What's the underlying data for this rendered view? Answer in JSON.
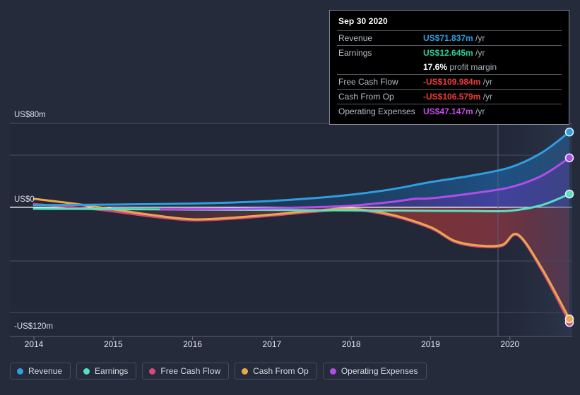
{
  "chart_data": {
    "type": "line",
    "title": "",
    "xlabel": "",
    "ylabel": "",
    "x_tick_labels": [
      "2014",
      "2015",
      "2016",
      "2017",
      "2018",
      "2019",
      "2020"
    ],
    "y_tick_labels": [
      "US$80m",
      "US$0",
      "-US$120m"
    ],
    "ylim": [
      -120,
      80
    ],
    "xlim": [
      2014,
      2020.75
    ],
    "grid": true,
    "legend_position": "bottom-left",
    "currency": "US$",
    "units": "millions",
    "series": [
      {
        "name": "Revenue",
        "color": "#2e9fe0",
        "x": [
          2014.0,
          2014.5,
          2015.0,
          2015.5,
          2016.0,
          2016.5,
          2017.0,
          2017.5,
          2018.0,
          2018.5,
          2019.0,
          2019.5,
          2020.0,
          2020.4,
          2020.75
        ],
        "values": [
          2.0,
          2.2,
          2.6,
          3.0,
          3.5,
          4.5,
          6.0,
          8.5,
          12.0,
          17.0,
          24.0,
          30.0,
          38.0,
          52.0,
          71.837
        ]
      },
      {
        "name": "Earnings",
        "color": "#55dfc3",
        "x": [
          2014.0,
          2014.5,
          2015.0,
          2015.5,
          2016.0,
          2016.5,
          2017.0,
          2017.5,
          2018.0,
          2018.5,
          2019.0,
          2019.5,
          2020.0,
          2020.4,
          2020.75
        ],
        "values": [
          -1.5,
          -1.6,
          -1.8,
          -2.0,
          -2.2,
          -2.4,
          -2.6,
          -2.8,
          -3.0,
          -3.2,
          -3.4,
          -3.6,
          -3.4,
          2.0,
          12.645
        ]
      },
      {
        "name": "Free Cash Flow",
        "color": "#d8487b",
        "x": [
          2014.0,
          2014.5,
          2015.0,
          2015.5,
          2016.0,
          2016.5,
          2017.0,
          2017.5,
          2018.0,
          2018.5,
          2019.0,
          2019.3,
          2019.6,
          2019.9,
          2020.1,
          2020.4,
          2020.75
        ],
        "values": [
          3.0,
          0.0,
          -4.0,
          -9.0,
          -12.5,
          -11.0,
          -8.0,
          -4.5,
          -2.5,
          -8.0,
          -20.0,
          -33.0,
          -37.5,
          -37.0,
          -27.0,
          -60.0,
          -109.984
        ]
      },
      {
        "name": "Cash From Op",
        "color": "#e8a84c",
        "x": [
          2014.0,
          2014.5,
          2015.0,
          2015.5,
          2016.0,
          2016.5,
          2017.0,
          2017.5,
          2018.0,
          2018.5,
          2019.0,
          2019.3,
          2019.6,
          2019.9,
          2020.1,
          2020.4,
          2020.75
        ],
        "values": [
          8.0,
          3.5,
          -2.0,
          -7.5,
          -11.5,
          -10.0,
          -7.0,
          -3.5,
          -1.5,
          -7.0,
          -19.0,
          -32.0,
          -36.5,
          -36.0,
          -26.0,
          -58.0,
          -106.579
        ]
      },
      {
        "name": "Operating Expenses",
        "color": "#b44ce8",
        "x": [
          2015.6,
          2016.0,
          2016.5,
          2017.0,
          2017.5,
          2018.0,
          2018.5,
          2018.8,
          2019.0,
          2019.5,
          2020.0,
          2020.4,
          2020.75
        ],
        "values": [
          -2.0,
          -1.8,
          -1.5,
          -1.0,
          0.0,
          1.5,
          5.0,
          8.0,
          8.5,
          13.0,
          19.0,
          30.0,
          47.147
        ]
      }
    ],
    "forecast_divider_x": 2019.85,
    "endpoints": [
      {
        "series": "Revenue",
        "value": 71.837
      },
      {
        "series": "Operating Expenses",
        "value": 47.147
      },
      {
        "series": "Earnings",
        "value": 12.645
      },
      {
        "series": "Free Cash Flow",
        "value": -109.984
      },
      {
        "series": "Cash From Op",
        "value": -106.579
      }
    ]
  },
  "tooltip": {
    "title": "Sep 30 2020",
    "rows": [
      {
        "label": "Revenue",
        "value": "US$71.837m",
        "unit": "/yr",
        "color": "#2e9fe0"
      },
      {
        "label": "Earnings",
        "value": "US$12.645m",
        "unit": "/yr",
        "color": "#2ecc9b"
      },
      {
        "label": "",
        "value": "17.6%",
        "unit": "profit margin",
        "color": "#ffffff"
      },
      {
        "label": "Free Cash Flow",
        "value": "-US$109.984m",
        "unit": "/yr",
        "color": "#ef3b3b"
      },
      {
        "label": "Cash From Op",
        "value": "-US$106.579m",
        "unit": "/yr",
        "color": "#ef3b3b"
      },
      {
        "label": "Operating Expenses",
        "value": "US$47.147m",
        "unit": "/yr",
        "color": "#c44ce8"
      }
    ]
  },
  "legend": {
    "items": [
      {
        "label": "Revenue",
        "color": "#2e9fe0"
      },
      {
        "label": "Earnings",
        "color": "#55dfc3"
      },
      {
        "label": "Free Cash Flow",
        "color": "#d8487b"
      },
      {
        "label": "Cash From Op",
        "color": "#e8a84c"
      },
      {
        "label": "Operating Expenses",
        "color": "#b44ce8"
      }
    ]
  },
  "colors": {
    "background": "#252b3b",
    "plot_background": "#222838",
    "gridline": "#4a5163",
    "zero_line": "#ffffff",
    "axis_text": "#d8dde6"
  }
}
